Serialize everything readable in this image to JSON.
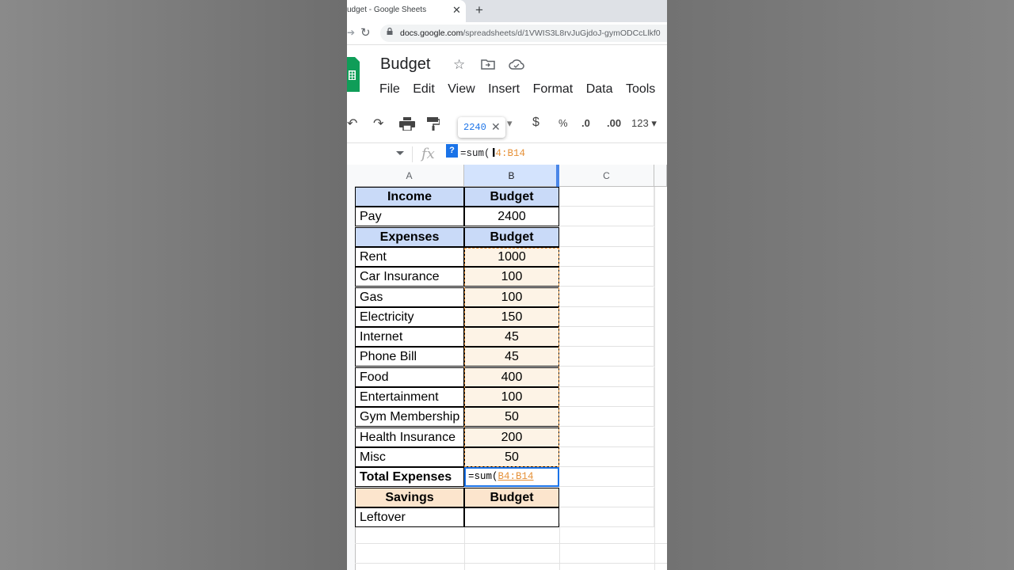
{
  "browser": {
    "tab_title": "udget - Google Sheets",
    "tab_close": "✕",
    "new_tab": "+",
    "url_host": "docs.google.com",
    "url_path": "/spreadsheets/d/1VWIS3L8rvJuGjdoJ-gymODCcLlkf0"
  },
  "doc": {
    "title": "Budget",
    "menu": [
      "File",
      "Edit",
      "View",
      "Insert",
      "Format",
      "Data",
      "Tools"
    ]
  },
  "toolbar": {
    "currency": "$",
    "percent": "%",
    "dec_decrease": ".0",
    "dec_increase": ".00",
    "more_formats": "123",
    "tooltip_value": "2240",
    "tooltip_close": "✕"
  },
  "formula_bar": {
    "fx": "fx",
    "help": "?",
    "formula_prefix": "=sum(",
    "formula_ref": "4:B14"
  },
  "columns": [
    "A",
    "B",
    "C"
  ],
  "table": {
    "rows": [
      {
        "a": "Income",
        "b": "Budget",
        "style": "hdr-blue"
      },
      {
        "a": "Pay",
        "b": "2400",
        "style": "plain"
      },
      {
        "a": "Expenses",
        "b": "Budget",
        "style": "hdr-blue"
      },
      {
        "a": "Rent",
        "b": "1000",
        "style": "range"
      },
      {
        "a": "Car Insurance",
        "b": "100",
        "style": "range"
      },
      {
        "a": "Gas",
        "b": "100",
        "style": "range"
      },
      {
        "a": "Electricity",
        "b": "150",
        "style": "range"
      },
      {
        "a": "Internet",
        "b": "45",
        "style": "range"
      },
      {
        "a": "Phone Bill",
        "b": "45",
        "style": "range"
      },
      {
        "a": "Food",
        "b": "400",
        "style": "range"
      },
      {
        "a": "Entertainment",
        "b": "100",
        "style": "range"
      },
      {
        "a": "Gym Membership",
        "b": "50",
        "style": "range"
      },
      {
        "a": "Health Insurance",
        "b": "200",
        "style": "range"
      },
      {
        "a": "Misc",
        "b": "50",
        "style": "range"
      },
      {
        "a": "Total Expenses",
        "b_prefix": "=sum(",
        "b_ref": "B4:B14",
        "style": "active"
      },
      {
        "a": "Savings",
        "b": "Budget",
        "style": "hdr-orange"
      },
      {
        "a": "Leftover",
        "b": "",
        "style": "plain"
      }
    ]
  }
}
